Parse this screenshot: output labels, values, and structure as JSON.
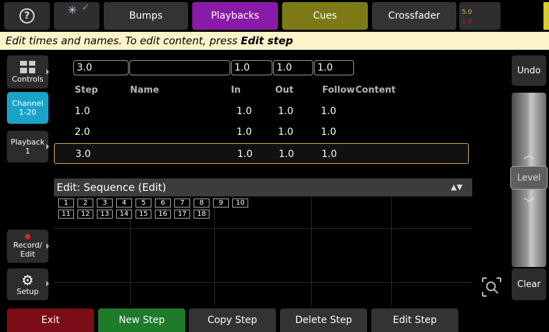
{
  "topbar": {
    "help_glyph": "?",
    "tabs": [
      {
        "label": "Bumps"
      },
      {
        "label": "Playbacks"
      },
      {
        "label": "Cues"
      },
      {
        "label": "Crossfader"
      }
    ],
    "fade_top": "5.0",
    "fade_bottom": "1.0",
    "colors": {
      "playbacks": "#8a1aa8",
      "cues": "#7d7a16",
      "status_strip": "#d8cc28"
    }
  },
  "hint": {
    "text": "Edit times and names. To edit content, press ",
    "bold": "Edit step"
  },
  "sidebar": {
    "controls": "Controls",
    "channel_line1": "Channel",
    "channel_line2": "1-20",
    "playback_line1": "Playback",
    "playback_line2": "1",
    "record_line1": "Record/",
    "record_line2": "Edit",
    "setup": "Setup",
    "accent": "#1aa3c9"
  },
  "editor": {
    "fields": {
      "step": "3.0",
      "name": "",
      "in": "1.0",
      "out": "1.0",
      "follow": "1.0"
    },
    "columns": {
      "step": "Step",
      "name": "Name",
      "in": "In",
      "out": "Out",
      "follow": "Follow",
      "content": "Content"
    },
    "rows": [
      {
        "step": "1.0",
        "in": "1.0",
        "out": "1.0",
        "follow": "1.0"
      },
      {
        "step": "2.0",
        "in": "1.0",
        "out": "1.0",
        "follow": "1.0"
      },
      {
        "step": "3.0",
        "in": "1.0",
        "out": "1.0",
        "follow": "1.0"
      }
    ],
    "selected_row": 2
  },
  "sequence": {
    "title": "Edit: Sequence (Edit)",
    "arrows": "▲▼",
    "steps": [
      "1",
      "2",
      "3",
      "4",
      "5",
      "6",
      "7",
      "8",
      "9",
      "10",
      "11",
      "12",
      "13",
      "14",
      "15",
      "16",
      "17",
      "18"
    ]
  },
  "right": {
    "undo": "Undo",
    "level": "Level",
    "clear": "Clear",
    "up_glyph": "︿",
    "down_glyph": "﹀"
  },
  "bottom": {
    "exit": "Exit",
    "new_step": "New Step",
    "copy_step": "Copy Step",
    "delete_step": "Delete Step",
    "edit_step": "Edit Step"
  }
}
